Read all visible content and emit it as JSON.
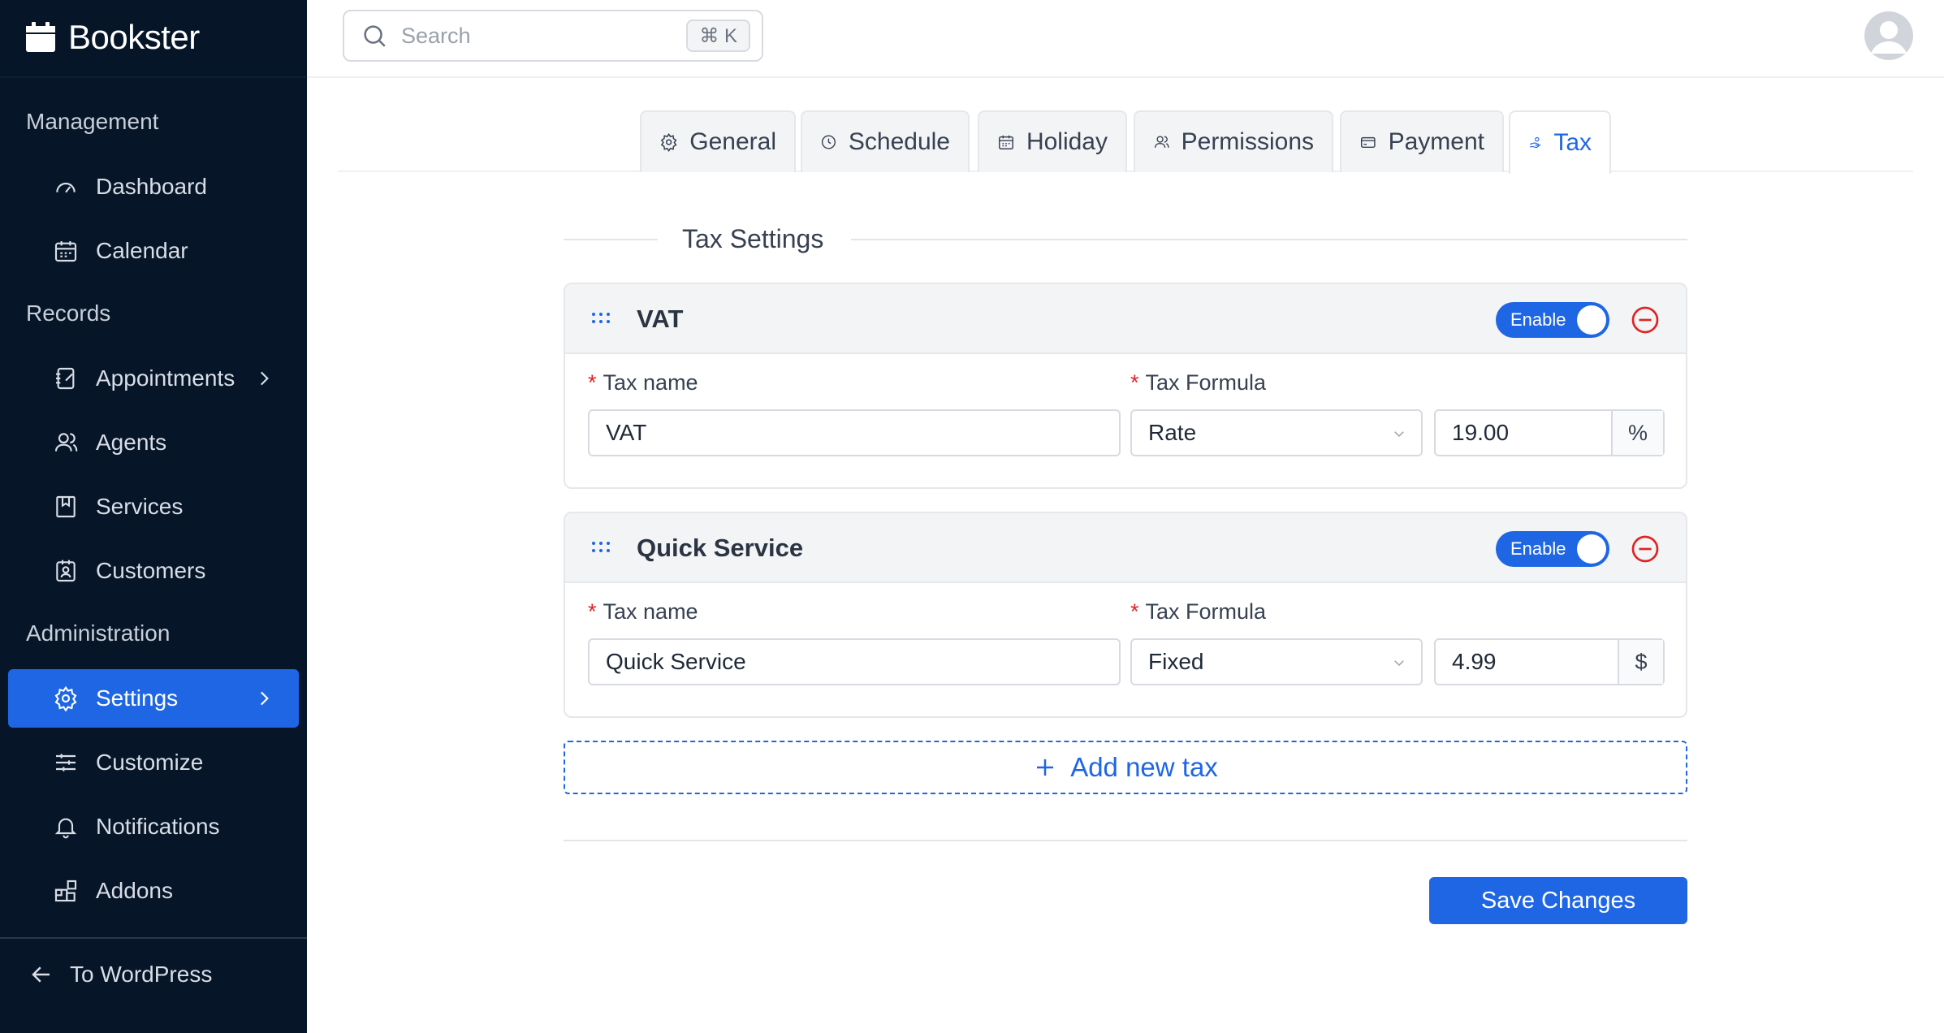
{
  "app": {
    "name": "Bookster"
  },
  "sidebar": {
    "sections": [
      "Management",
      "Records",
      "Administration"
    ],
    "items": [
      {
        "label": "Dashboard",
        "icon": "gauge-icon"
      },
      {
        "label": "Calendar",
        "icon": "calendar-icon"
      },
      {
        "label": "Appointments",
        "icon": "notebook-icon"
      },
      {
        "label": "Agents",
        "icon": "user-icon"
      },
      {
        "label": "Services",
        "icon": "bookmark-icon"
      },
      {
        "label": "Customers",
        "icon": "contact-icon"
      },
      {
        "label": "Settings",
        "icon": "gear-icon",
        "active": true
      },
      {
        "label": "Customize",
        "icon": "sliders-icon"
      },
      {
        "label": "Notifications",
        "icon": "bell-icon"
      },
      {
        "label": "Addons",
        "icon": "blocks-icon"
      }
    ],
    "back_label": "To WordPress"
  },
  "search": {
    "placeholder": "Search",
    "shortcut": "⌘ K"
  },
  "tabs": [
    {
      "label": "General",
      "icon": "gear-icon"
    },
    {
      "label": "Schedule",
      "icon": "clock-icon"
    },
    {
      "label": "Holiday",
      "icon": "calendar-icon"
    },
    {
      "label": "Permissions",
      "icon": "users-icon"
    },
    {
      "label": "Payment",
      "icon": "card-icon"
    },
    {
      "label": "Tax",
      "icon": "tax-icon",
      "active": true
    }
  ],
  "content": {
    "section_title": "Tax Settings",
    "taxes": [
      {
        "title": "VAT",
        "toggle_label": "Enable",
        "name_label": "Tax name",
        "formula_label": "Tax Formula",
        "name_value": "VAT",
        "formula_value": "Rate",
        "amount_value": "19.00",
        "unit": "%"
      },
      {
        "title": "Quick Service",
        "toggle_label": "Enable",
        "name_label": "Tax name",
        "formula_label": "Tax Formula",
        "name_value": "Quick Service",
        "formula_value": "Fixed",
        "amount_value": "4.99",
        "unit": "$"
      }
    ],
    "add_label": "Add new tax",
    "save_label": "Save Changes"
  },
  "colors": {
    "sidebar_bg": "#061528",
    "accent": "#1f66e5",
    "danger": "#e02424"
  }
}
